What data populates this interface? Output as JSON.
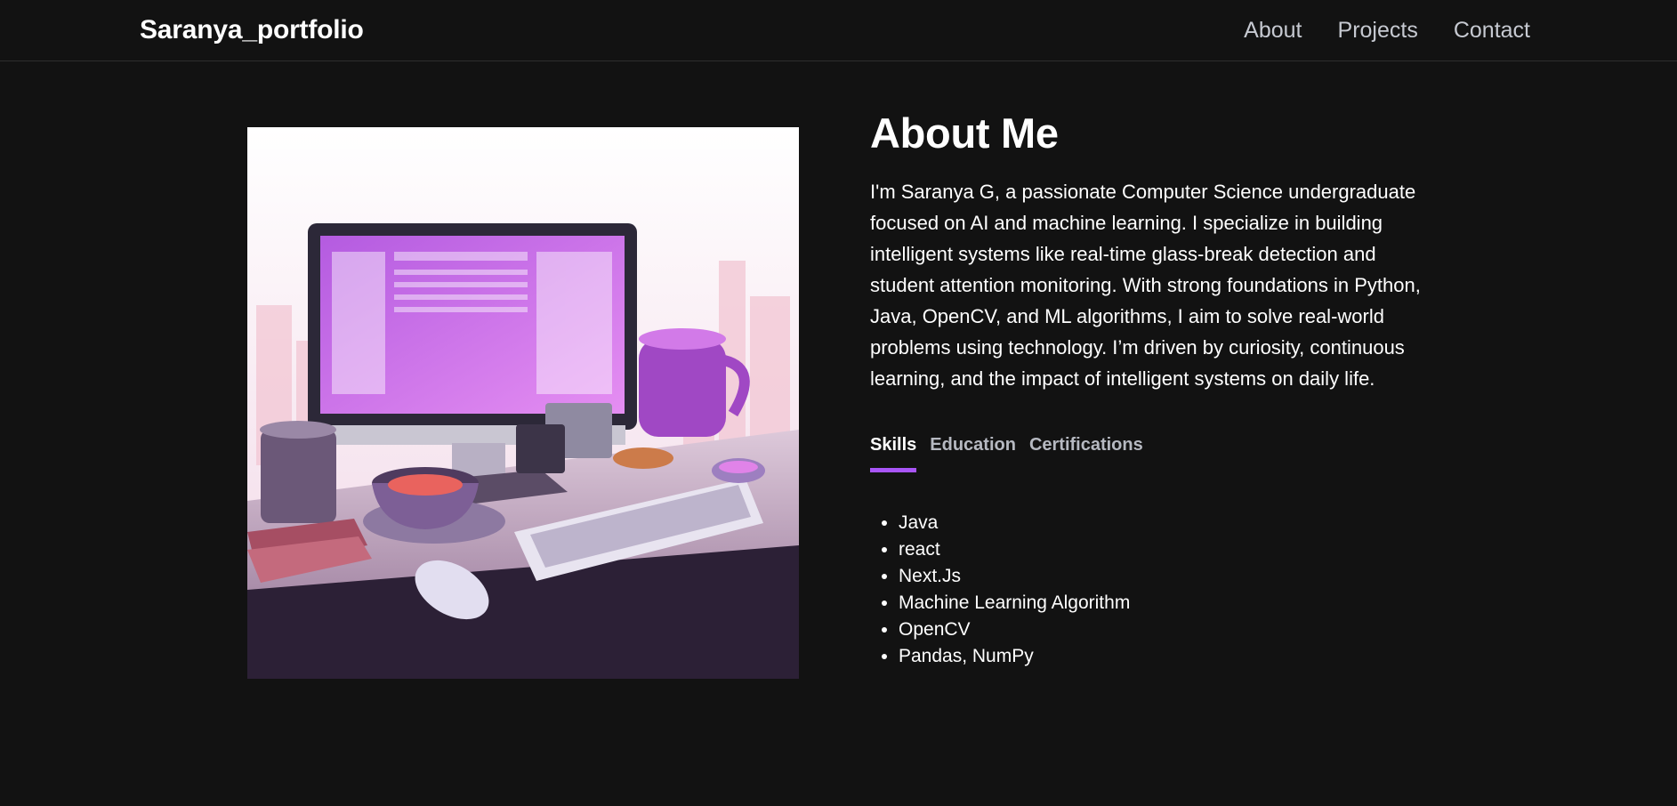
{
  "nav": {
    "brand": "Saranya_portfolio",
    "links": [
      "About",
      "Projects",
      "Contact"
    ]
  },
  "hero_image": {
    "description_icon": "workspace-illustration",
    "colors": {
      "accent": "#c25ce8",
      "background": "#f6eef5",
      "desk": "#c9b3c8"
    }
  },
  "about": {
    "title": "About Me",
    "paragraph": "I'm Saranya G, a passionate Computer Science undergraduate focused on AI and machine learning. I specialize in building intelligent systems like real-time glass-break detection and student attention monitoring. With strong foundations in Python, Java, OpenCV, and ML algorithms, I aim to solve real-world problems using technology. I’m driven by curiosity, continuous learning, and the impact of intelligent systems on daily life.",
    "tabs": [
      "Skills",
      "Education",
      "Certifications"
    ],
    "active_tab": "Skills",
    "skills": [
      "Java",
      "react",
      "Next.Js",
      "Machine Learning Algorithm",
      "OpenCV",
      "Pandas, NumPy"
    ]
  },
  "theme": {
    "background": "#121212",
    "tab_underline": "#a855f7",
    "nav_text": "#c6c9d1"
  }
}
